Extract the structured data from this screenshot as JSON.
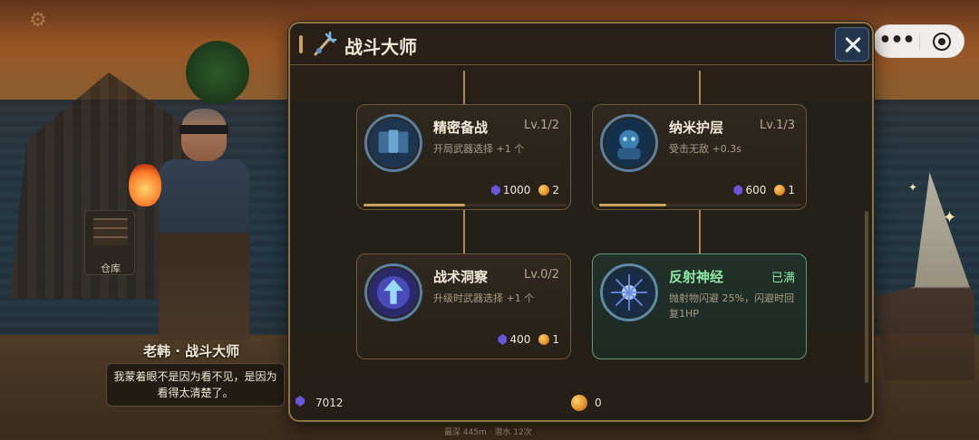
{
  "panel": {
    "title": "战斗大师",
    "close_label": "关闭"
  },
  "npc": {
    "name": "老韩 · 战斗大师",
    "speech": "我蒙着眼不是因为看不见，是因为看得太清楚了。",
    "storage_label": "仓库"
  },
  "skills": [
    {
      "name": "精密备战",
      "level": "Lv.1/2",
      "desc": "开局武器选择 +1 个",
      "gem_cost": "1000",
      "coin_cost": "2",
      "progress": 0.5,
      "icon": "cards-icon",
      "maxed": false
    },
    {
      "name": "纳米护层",
      "level": "Lv.1/3",
      "desc": "受击无敌 +0.3s",
      "gem_cost": "600",
      "coin_cost": "1",
      "progress": 0.33,
      "icon": "mech-suit-icon",
      "maxed": false
    },
    {
      "name": "战术洞察",
      "level": "Lv.0/2",
      "desc": "升级时武器选择 +1 个",
      "gem_cost": "400",
      "coin_cost": "1",
      "progress": 0,
      "icon": "upgrade-arrow-icon",
      "maxed": false
    },
    {
      "name": "反射神经",
      "level": "已满",
      "desc": "抛射物闪避 25%，闪避时回复1HP",
      "gem_cost": "",
      "coin_cost": "",
      "progress": 1,
      "icon": "neuron-icon",
      "maxed": true
    }
  ],
  "currency": {
    "gems": "7012",
    "coins": "0"
  },
  "footer": "最深 445m · 潜水 12次",
  "colors": {
    "panel_border": "#8b7346",
    "maxed_green": "#8ee6a2",
    "gem_purple": "#6a56d8",
    "close_button": "#23364e"
  }
}
